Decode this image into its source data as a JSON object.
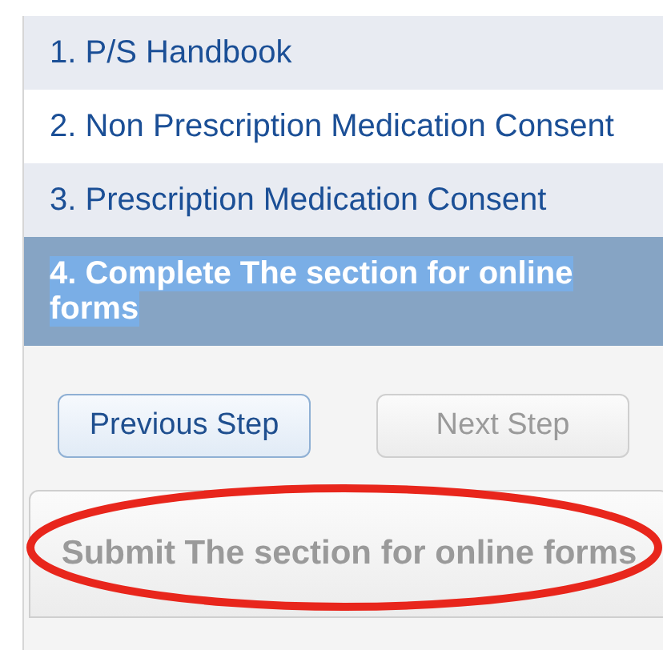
{
  "steps": [
    {
      "label": "1. P/S Handbook",
      "selected": false
    },
    {
      "label": "2. Non Prescription Medication Consent",
      "selected": false
    },
    {
      "label": "3. Prescription Medication Consent",
      "selected": false
    },
    {
      "label": "4. Complete The section for online forms",
      "selected": true
    }
  ],
  "nav_buttons": [
    {
      "label": "Previous Step",
      "disabled": false
    },
    {
      "label": "Next Step",
      "disabled": true
    }
  ],
  "submit_button": {
    "label": "Submit The section for online forms",
    "disabled": true,
    "circled": true
  }
}
